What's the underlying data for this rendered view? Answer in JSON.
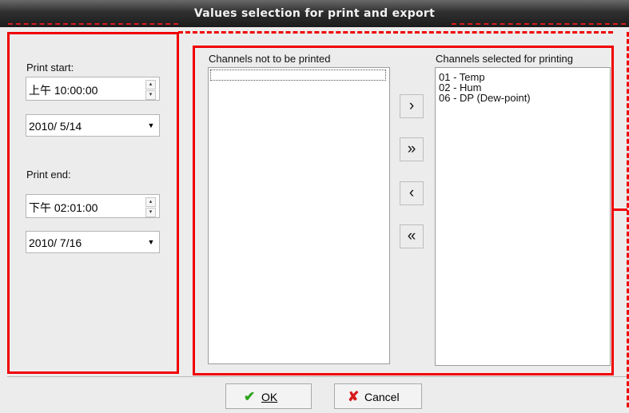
{
  "window": {
    "title": "Values selection for print and export"
  },
  "print_start": {
    "label": "Print start:",
    "time": "上午 10:00:00",
    "date": "2010/  5/14"
  },
  "print_end": {
    "label": "Print end:",
    "time": "下午 02:01:00",
    "date": "2010/  7/16"
  },
  "spin_glyphs": {
    "up": "▴",
    "down": "▾"
  },
  "dropdown_glyph": "▼",
  "lists": {
    "not_printed": {
      "label": "Channels not to be printed",
      "items": []
    },
    "selected": {
      "label": "Channels selected for printing",
      "items": [
        "01 - Temp",
        "02 - Hum",
        "06 - DP (Dew-point)"
      ]
    }
  },
  "move_buttons": {
    "add": "›",
    "add_all": "»",
    "remove": "‹",
    "remove_all": "«"
  },
  "buttons": {
    "ok": {
      "icon": "✔",
      "label": "OK",
      "icon_color": "#2fa51d"
    },
    "cancel": {
      "icon": "✘",
      "label": "Cancel",
      "icon_color": "#d81b1b"
    }
  }
}
